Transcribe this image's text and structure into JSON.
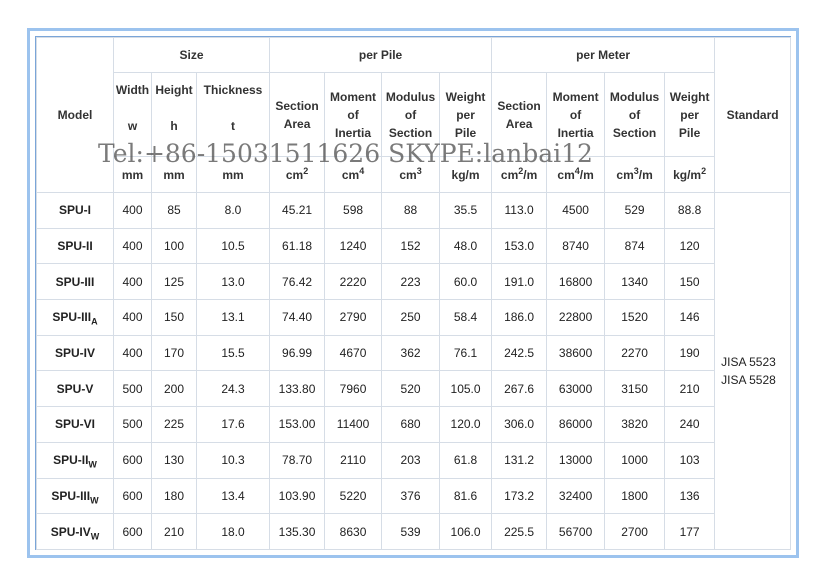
{
  "headers": {
    "size": "Size",
    "per_pile": "per Pile",
    "per_meter": "per Meter",
    "model": "Model",
    "standard": "Standard",
    "width": "Width",
    "height": "Height",
    "thickness": "Thickness",
    "w": "w",
    "h": "h",
    "t": "t",
    "mm": "mm",
    "section_area_1": "Section",
    "section_area_2": "Area",
    "moment_1": "Moment",
    "moment_2": "of",
    "moment_3": "Inertia",
    "modulus_1": "Modulus",
    "modulus_2": "of",
    "modulus_3": "Section",
    "weight_1": "Weight",
    "weight_2": "per",
    "weight_3": "Pile",
    "unit_cm": "cm",
    "unit_2": "2",
    "unit_4": "4",
    "unit_3": "3",
    "unit_kgm": "kg/m",
    "unit_per_m": "/m"
  },
  "rows": [
    {
      "model": "SPU-I",
      "sub": "",
      "w": "400",
      "h": "85",
      "t": "8.0",
      "a": "45.21",
      "i": "598",
      "z": "88",
      "wt": "35.5",
      "am": "113.0",
      "im": "4500",
      "zm": "529",
      "wm": "88.8"
    },
    {
      "model": "SPU-II",
      "sub": "",
      "w": "400",
      "h": "100",
      "t": "10.5",
      "a": "61.18",
      "i": "1240",
      "z": "152",
      "wt": "48.0",
      "am": "153.0",
      "im": "8740",
      "zm": "874",
      "wm": "120"
    },
    {
      "model": "SPU-III",
      "sub": "",
      "w": "400",
      "h": "125",
      "t": "13.0",
      "a": "76.42",
      "i": "2220",
      "z": "223",
      "wt": "60.0",
      "am": "191.0",
      "im": "16800",
      "zm": "1340",
      "wm": "150"
    },
    {
      "model": "SPU-III",
      "sub": "A",
      "w": "400",
      "h": "150",
      "t": "13.1",
      "a": "74.40",
      "i": "2790",
      "z": "250",
      "wt": "58.4",
      "am": "186.0",
      "im": "22800",
      "zm": "1520",
      "wm": "146"
    },
    {
      "model": "SPU-IV",
      "sub": "",
      "w": "400",
      "h": "170",
      "t": "15.5",
      "a": "96.99",
      "i": "4670",
      "z": "362",
      "wt": "76.1",
      "am": "242.5",
      "im": "38600",
      "zm": "2270",
      "wm": "190"
    },
    {
      "model": "SPU-V",
      "sub": "",
      "w": "500",
      "h": "200",
      "t": "24.3",
      "a": "133.80",
      "i": "7960",
      "z": "520",
      "wt": "105.0",
      "am": "267.6",
      "im": "63000",
      "zm": "3150",
      "wm": "210"
    },
    {
      "model": "SPU-VI",
      "sub": "",
      "w": "500",
      "h": "225",
      "t": "17.6",
      "a": "153.00",
      "i": "11400",
      "z": "680",
      "wt": "120.0",
      "am": "306.0",
      "im": "86000",
      "zm": "3820",
      "wm": "240"
    },
    {
      "model": "SPU-II",
      "sub": "W",
      "w": "600",
      "h": "130",
      "t": "10.3",
      "a": "78.70",
      "i": "2110",
      "z": "203",
      "wt": "61.8",
      "am": "131.2",
      "im": "13000",
      "zm": "1000",
      "wm": "103"
    },
    {
      "model": "SPU-III",
      "sub": "W",
      "w": "600",
      "h": "180",
      "t": "13.4",
      "a": "103.90",
      "i": "5220",
      "z": "376",
      "wt": "81.6",
      "am": "173.2",
      "im": "32400",
      "zm": "1800",
      "wm": "136"
    },
    {
      "model": "SPU-IV",
      "sub": "W",
      "w": "600",
      "h": "210",
      "t": "18.0",
      "a": "135.30",
      "i": "8630",
      "z": "539",
      "wt": "106.0",
      "am": "225.5",
      "im": "56700",
      "zm": "2700",
      "wm": "177"
    }
  ],
  "standard_lines": [
    "JISA 5523",
    "JISA 5528"
  ],
  "watermark": "Tel:+86-15031511626 SKYPE:lanbai12"
}
